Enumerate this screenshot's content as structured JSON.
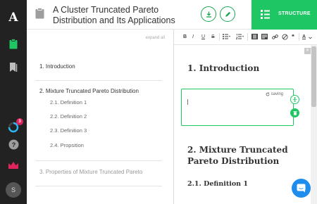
{
  "rail": {
    "logo": "A",
    "notification_count": "3",
    "avatar_initial": "S"
  },
  "header": {
    "title": "A Cluster Truncated Pareto Distribution and Its Applications",
    "structure_label": "STRUCTURE"
  },
  "structure": {
    "expand_all": "expand all",
    "sections": [
      {
        "label": "1. Introduction"
      },
      {
        "label": "2. Mixture Truncated Pareto Distribution",
        "children": [
          "2.1. Definition 1",
          "2.2. Definition 2",
          "2.3. Definition 3",
          "2.4. Propsition"
        ]
      },
      {
        "label": "3. Properties of Mixture Truncated Pareto Distribution"
      }
    ]
  },
  "toolbar": {
    "bold": "B",
    "italic": "I",
    "underline": "U",
    "strike": "S",
    "quote": "❝",
    "font_color": "A"
  },
  "editor": {
    "heading1": "1. Introduction",
    "saving_label": "saving",
    "heading2": "2. Mixture Truncated Pareto Distribution",
    "heading3": "2.1. Definition 1"
  },
  "colors": {
    "accent": "#1ec764",
    "rail": "#222222",
    "chat": "#1f8ded"
  }
}
